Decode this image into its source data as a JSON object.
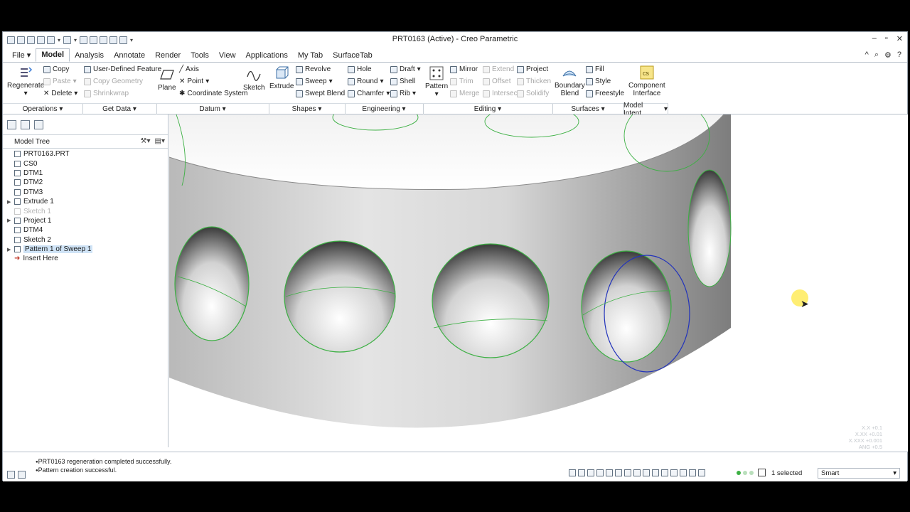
{
  "window": {
    "title": "PRT0163 (Active) - Creo Parametric"
  },
  "menu_tabs": [
    {
      "label": "File"
    },
    {
      "label": "Model"
    },
    {
      "label": "Analysis"
    },
    {
      "label": "Annotate"
    },
    {
      "label": "Render"
    },
    {
      "label": "Tools"
    },
    {
      "label": "View"
    },
    {
      "label": "Applications"
    },
    {
      "label": "My Tab"
    },
    {
      "label": "SurfaceTab"
    }
  ],
  "active_tab": "Model",
  "ribbon": {
    "regenerate": "Regenerate",
    "copy": "Copy",
    "paste": "Paste",
    "delete": "Delete",
    "user_defined_feature": "User-Defined Feature",
    "copy_geometry": "Copy Geometry",
    "shrinkwrap": "Shrinkwrap",
    "plane": "Plane",
    "axis": "Axis",
    "point": "Point",
    "coordinate_system": "Coordinate System",
    "sketch": "Sketch",
    "extrude": "Extrude",
    "revolve": "Revolve",
    "sweep": "Sweep",
    "swept_blend": "Swept Blend",
    "hole": "Hole",
    "round": "Round",
    "chamfer": "Chamfer",
    "draft": "Draft",
    "shell": "Shell",
    "rib": "Rib",
    "pattern": "Pattern",
    "mirror": "Mirror",
    "trim": "Trim",
    "merge": "Merge",
    "extend": "Extend",
    "offset": "Offset",
    "intersect": "Intersect",
    "project": "Project",
    "thicken": "Thicken",
    "solidify": "Solidify",
    "boundary_blend_1": "Boundary",
    "boundary_blend_2": "Blend",
    "fill": "Fill",
    "style": "Style",
    "freestyle": "Freestyle",
    "component_interface_1": "Component",
    "component_interface_2": "Interface"
  },
  "groups": {
    "operations": "Operations",
    "get_data": "Get Data",
    "datum": "Datum",
    "shapes": "Shapes",
    "engineering": "Engineering",
    "editing": "Editing",
    "surfaces": "Surfaces",
    "model_intent": "Model Intent"
  },
  "model_tree": {
    "header": "Model Tree",
    "nodes": [
      {
        "label": "PRT0163.PRT"
      },
      {
        "label": "CS0"
      },
      {
        "label": "DTM1"
      },
      {
        "label": "DTM2"
      },
      {
        "label": "DTM3"
      },
      {
        "label": "Extrude 1"
      },
      {
        "label": "Sketch 1"
      },
      {
        "label": "Project 1"
      },
      {
        "label": "DTM4"
      },
      {
        "label": "Sketch 2"
      },
      {
        "label": "Pattern 1 of Sweep 1"
      },
      {
        "label": "Insert Here"
      }
    ]
  },
  "status": {
    "messages": [
      "PRT0163 regeneration completed successfully.",
      "Pattern creation successful."
    ],
    "selected": "1 selected",
    "filter": "Smart"
  },
  "tolerance": {
    "l1": "X.X +0.1",
    "l2": "X.XX +0.01",
    "l3": "X.XXX +0.001",
    "l4": "ANG +0.5"
  },
  "colors": {
    "edge_highlight": "#3cb043",
    "selection": "#2233bb",
    "accent": "#cfe3f6"
  }
}
